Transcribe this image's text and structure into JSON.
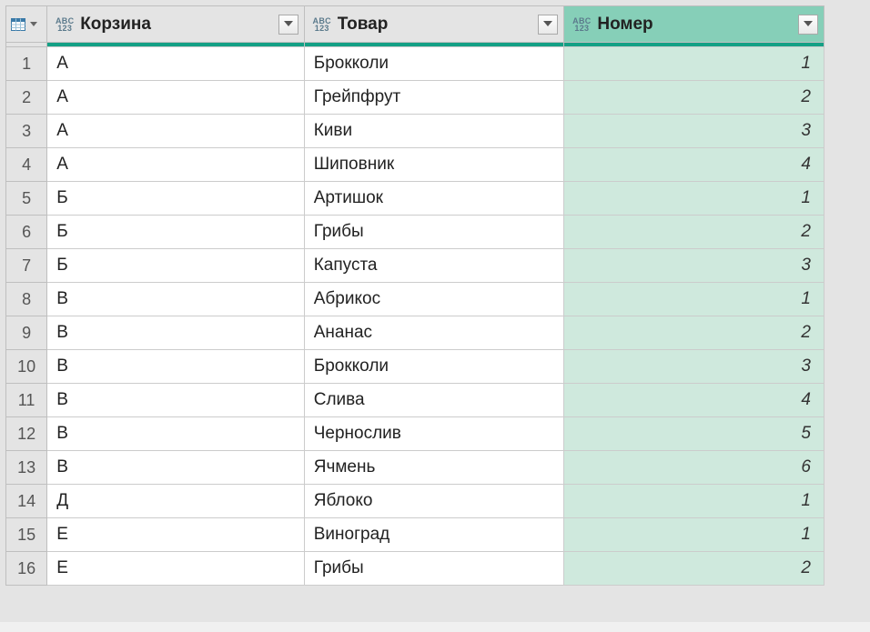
{
  "typeIcon": {
    "line1": "ABC",
    "line2": "123"
  },
  "columns": [
    {
      "name": "Корзина",
      "selected": false
    },
    {
      "name": "Товар",
      "selected": false
    },
    {
      "name": "Номер",
      "selected": true
    }
  ],
  "rows": [
    {
      "n": "1",
      "c0": "А",
      "c1": "Брокколи",
      "c2": "1"
    },
    {
      "n": "2",
      "c0": "А",
      "c1": "Грейпфрут",
      "c2": "2"
    },
    {
      "n": "3",
      "c0": "А",
      "c1": "Киви",
      "c2": "3"
    },
    {
      "n": "4",
      "c0": "А",
      "c1": "Шиповник",
      "c2": "4"
    },
    {
      "n": "5",
      "c0": "Б",
      "c1": "Артишок",
      "c2": "1"
    },
    {
      "n": "6",
      "c0": "Б",
      "c1": "Грибы",
      "c2": "2"
    },
    {
      "n": "7",
      "c0": "Б",
      "c1": "Капуста",
      "c2": "3"
    },
    {
      "n": "8",
      "c0": "В",
      "c1": "Абрикос",
      "c2": "1"
    },
    {
      "n": "9",
      "c0": "В",
      "c1": "Ананас",
      "c2": "2"
    },
    {
      "n": "10",
      "c0": "В",
      "c1": "Брокколи",
      "c2": "3"
    },
    {
      "n": "11",
      "c0": "В",
      "c1": "Слива",
      "c2": "4"
    },
    {
      "n": "12",
      "c0": "В",
      "c1": "Чернослив",
      "c2": "5"
    },
    {
      "n": "13",
      "c0": "В",
      "c1": "Ячмень",
      "c2": "6"
    },
    {
      "n": "14",
      "c0": "Д",
      "c1": "Яблоко",
      "c2": "1"
    },
    {
      "n": "15",
      "c0": "Е",
      "c1": "Виноград",
      "c2": "1"
    },
    {
      "n": "16",
      "c0": "Е",
      "c1": "Грибы",
      "c2": "2"
    }
  ]
}
